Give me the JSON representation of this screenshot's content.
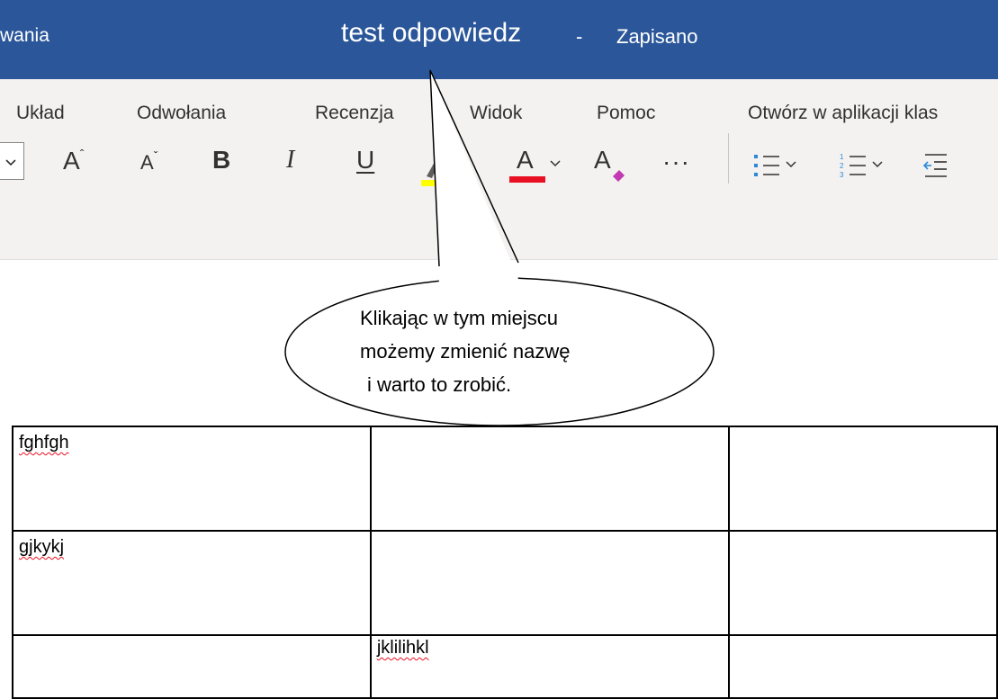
{
  "titlebar": {
    "left_fragment": "wania",
    "doc_title": "test odpowiedz",
    "separator": "-",
    "status": "Zapisano",
    "bg_color": "#2b579a"
  },
  "ribbon": {
    "menu": [
      "Układ",
      "Odwołania",
      "Recenzja",
      "Widok",
      "Pomoc",
      "Otwórz w aplikacji klas"
    ],
    "tools": {
      "grow_font": "A",
      "shrink_font": "A",
      "bold": "B",
      "italic": "I",
      "underline": "U",
      "font_color": "A",
      "clear_format": "A",
      "more": "···"
    },
    "highlight_color": "#ffff00",
    "font_color_bar": "#e81123",
    "clear_format_color": "#c239b3",
    "icons": [
      "dropdown-icon",
      "bullets-icon",
      "numbering-icon",
      "decrease-indent-icon"
    ]
  },
  "callout": {
    "line1": "Klikając w tym miejscu",
    "line2": "możemy zmienić nazwę",
    "line3": "i warto to zrobić."
  },
  "table": {
    "rows": [
      [
        "fghfgh",
        "",
        ""
      ],
      [
        "gjkykj",
        "",
        ""
      ],
      [
        "",
        "jklilihkl",
        ""
      ]
    ]
  }
}
